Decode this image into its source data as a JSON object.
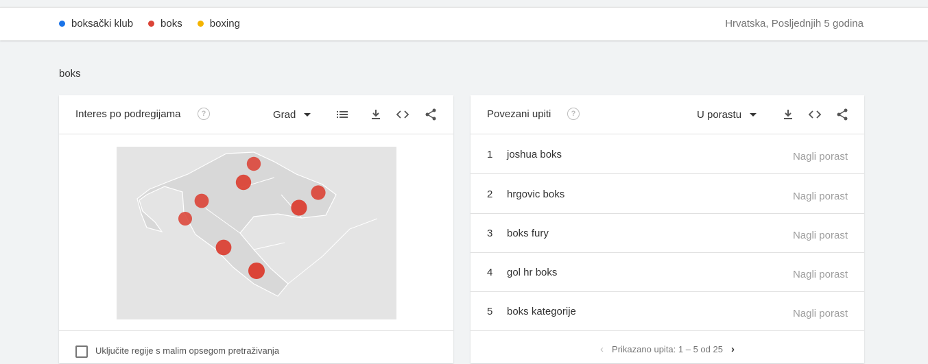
{
  "legend": [
    {
      "label": "boksački klub",
      "color": "#1a73e8"
    },
    {
      "label": "boks",
      "color": "#db4437"
    },
    {
      "label": "boxing",
      "color": "#f4b400"
    }
  ],
  "filters_text": "Hrvatska, Posljednjih 5 godina",
  "section_title": "boks",
  "left_card": {
    "title": "Interes po podregijama",
    "help_icon": "help-circle-icon",
    "resolution_label": "Grad",
    "icons": [
      "list-icon",
      "download-icon",
      "embed-icon",
      "share-icon"
    ],
    "map": {
      "country": "Hrvatska",
      "marker_color": "#db4437",
      "markers": [
        {
          "name": "city-1",
          "intensity": 0.55
        },
        {
          "name": "city-2",
          "intensity": 0.8
        },
        {
          "name": "city-3",
          "intensity": 0.6
        },
        {
          "name": "city-4",
          "intensity": 0.5
        },
        {
          "name": "city-5",
          "intensity": 0.65
        },
        {
          "name": "city-6",
          "intensity": 0.9
        },
        {
          "name": "city-7",
          "intensity": 0.85
        },
        {
          "name": "city-8",
          "intensity": 1.0
        }
      ]
    },
    "footer_checkbox_label": "Uključite regije s malim opsegom pretraživanja",
    "footer_checked": false
  },
  "right_card": {
    "title": "Povezani upiti",
    "help_icon": "help-circle-icon",
    "sort_label": "U porastu",
    "icons": [
      "download-icon",
      "embed-icon",
      "share-icon"
    ],
    "rows": [
      {
        "rank": "1",
        "term": "joshua boks",
        "value": "Nagli porast"
      },
      {
        "rank": "2",
        "term": "hrgovic boks",
        "value": "Nagli porast"
      },
      {
        "rank": "3",
        "term": "boks fury",
        "value": "Nagli porast"
      },
      {
        "rank": "4",
        "term": "gol hr boks",
        "value": "Nagli porast"
      },
      {
        "rank": "5",
        "term": "boks kategorije",
        "value": "Nagli porast"
      }
    ],
    "pager_text": "Prikazano upita: 1 – 5 od 25"
  }
}
